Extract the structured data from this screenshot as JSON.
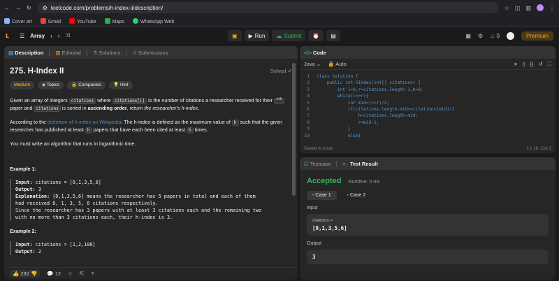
{
  "browser": {
    "url": "leetcode.com/problems/h-index-ii/description/"
  },
  "bookmarks": [
    {
      "label": "Cover art",
      "color": "#8ab4f8"
    },
    {
      "label": "Gmail",
      "color": "#ea4335"
    },
    {
      "label": "YouTube",
      "color": "#ff0000"
    },
    {
      "label": "Maps",
      "color": "#34a853"
    },
    {
      "label": "WhatsApp Web",
      "color": "#25d366"
    }
  ],
  "nav": {
    "section": "Array",
    "run": "Run",
    "submit": "Submit",
    "streak": "0",
    "premium": "Premium"
  },
  "tabs": {
    "description": "Description",
    "editorial": "Editorial",
    "solutions": "Solutions",
    "submissions": "Submissions"
  },
  "problem": {
    "title": "275. H-Index II",
    "solved": "Solved",
    "tags": [
      "Medium",
      "Topics",
      "Companies",
      "Hint"
    ],
    "p1": {
      "a": "Given an array of integers ",
      "c1": "citations",
      "b": " where ",
      "c2": "citations[i]",
      "c": " is the number of citations a researcher received for their ",
      "sup": "ith",
      "d": " paper and ",
      "c3": "citations",
      "e": " is sorted in ",
      "bold": "ascending order",
      "f": ", return ",
      "it": "the researcher's h-index",
      "g": "."
    },
    "p2": {
      "a": "According to the ",
      "link": "definition of h-index on Wikipedia",
      "b": ": The h-index is defined as the maximum value of ",
      "c1": "h",
      "c": " such that the given researcher has published at least ",
      "c2": "h",
      "d": " papers that have each been cited at least ",
      "c3": "h",
      "e": " times."
    },
    "p3": "You must write an algorithm that runs in logarithmic time.",
    "ex1": {
      "h": "Example 1:",
      "in_l": "Input:",
      "in": " citations = [0,1,3,5,6]",
      "out_l": "Output:",
      "out": " 3",
      "exp_l": "Explanation:",
      "exp1": " [0,1,3,5,6] means the researcher has 5 papers in total and each of them",
      "exp2": "had received 0, 1, 3, 5, 6 citations respectively.",
      "exp3": "Since the researcher has 3 papers with at least 3 citations each and the remaining two",
      "exp4": "with no more than 3 citations each, their h-index is 3."
    },
    "ex2": {
      "h": "Example 2:",
      "in_l": "Input:",
      "in": " citations = [1,2,100]",
      "out_l": "Output:",
      "out": " 2"
    }
  },
  "footer": {
    "likes": "282",
    "comments": "12"
  },
  "code": {
    "tab": "Code",
    "lang": "Java",
    "auto": "Auto",
    "saved": "Saved to local",
    "pos": "Ln 16, Col 2"
  },
  "codeLines": [
    {
      "n": "1",
      "t": "class Solution {"
    },
    {
      "n": "2",
      "t": "    public int hIndex(int[] citations) {"
    },
    {
      "n": "3",
      "t": "        int l=0,r=citations.length-1,h=0;"
    },
    {
      "n": "4",
      "t": "        while(l<=r){"
    },
    {
      "n": "5",
      "t": "            int mid=(l+r)/2;"
    },
    {
      "n": "6",
      "t": "            if(citations.length-mid<=citations[mid]){"
    },
    {
      "n": "7",
      "t": "                h=citations.length-mid;"
    },
    {
      "n": "8",
      "t": "                r=mid-1;"
    },
    {
      "n": "9",
      "t": "            }"
    },
    {
      "n": "10",
      "t": "            else{"
    }
  ],
  "result": {
    "testcase": "Testcase",
    "testresult": "Test Result",
    "status": "Accepted",
    "runtime": "Runtime: 0 ms",
    "case1": "Case 1",
    "case2": "Case 2",
    "input": "Input",
    "var": "citations =",
    "val": "[0,1,3,5,6]",
    "output": "Output",
    "outval": "3"
  }
}
